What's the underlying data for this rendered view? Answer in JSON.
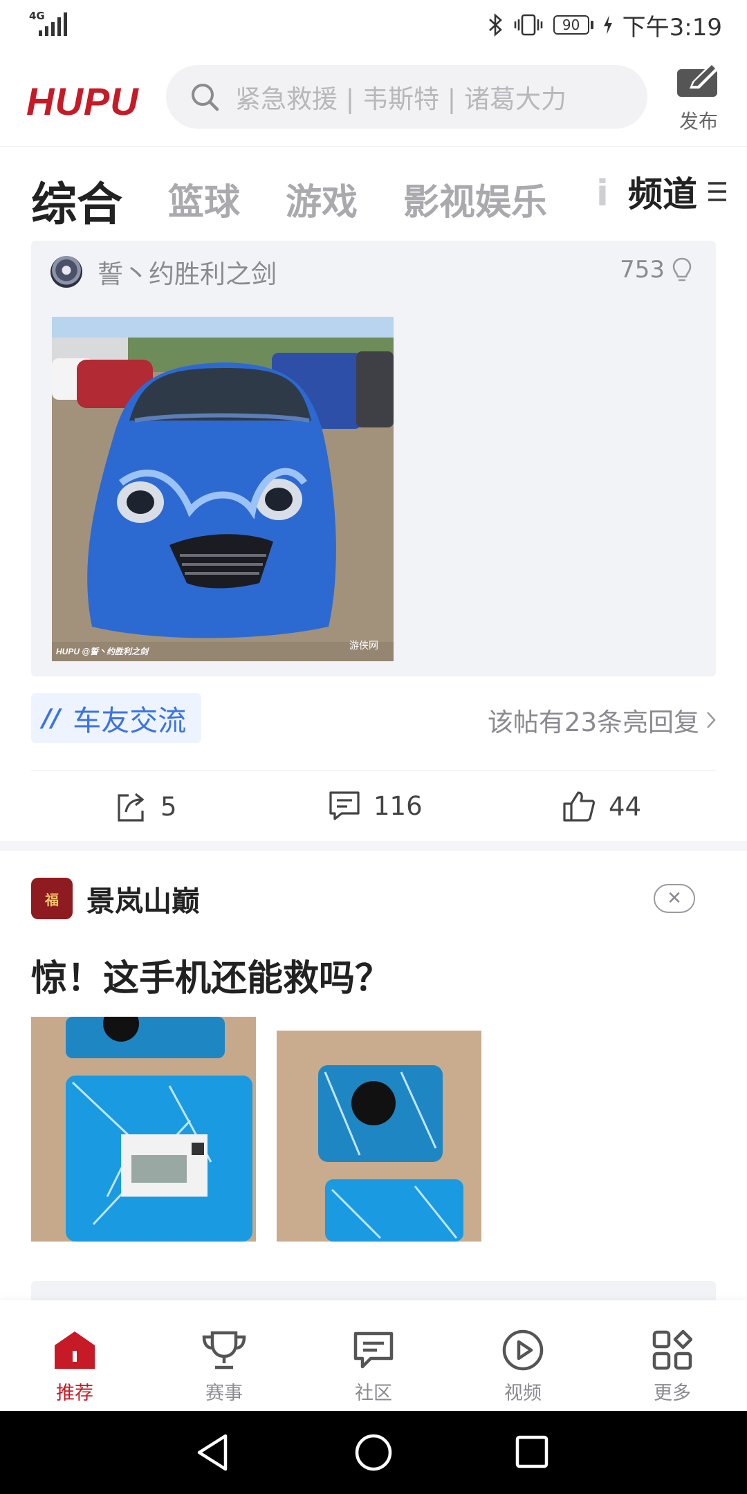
{
  "status_bar": {
    "network": "4G",
    "battery": "90",
    "time": "下午3:19"
  },
  "header": {
    "logo": "HUPU",
    "search_placeholder": "紧急救援 | 韦斯特 | 诸葛大力",
    "publish_label": "发布",
    "brand_color": "#c61a26"
  },
  "tabs": {
    "items": [
      {
        "label": "综合",
        "active": true
      },
      {
        "label": "篮球"
      },
      {
        "label": "游戏"
      },
      {
        "label": "影视娱乐"
      },
      {
        "label": "i"
      }
    ],
    "channel_label": "频道"
  },
  "post1": {
    "quote_author": "誓丶约胜利之剑",
    "quote_lights": "753",
    "image_watermark_left": "HUPU @誓丶约胜利之剑",
    "image_watermark_right": "游侠网",
    "topic": "车友交流",
    "reply_hint": "该帖有23条亮回复",
    "shares": "5",
    "comments": "116",
    "likes": "44"
  },
  "post2": {
    "author": "景岚山巅",
    "title": "惊！这手机还能救吗？"
  },
  "bottom_nav": [
    {
      "label": "推荐",
      "icon": "home-icon",
      "active": true
    },
    {
      "label": "赛事",
      "icon": "trophy-icon"
    },
    {
      "label": "社区",
      "icon": "chat-icon"
    },
    {
      "label": "视频",
      "icon": "play-icon"
    },
    {
      "label": "更多",
      "icon": "grid-icon"
    }
  ],
  "accent_color": "#3b73e6"
}
